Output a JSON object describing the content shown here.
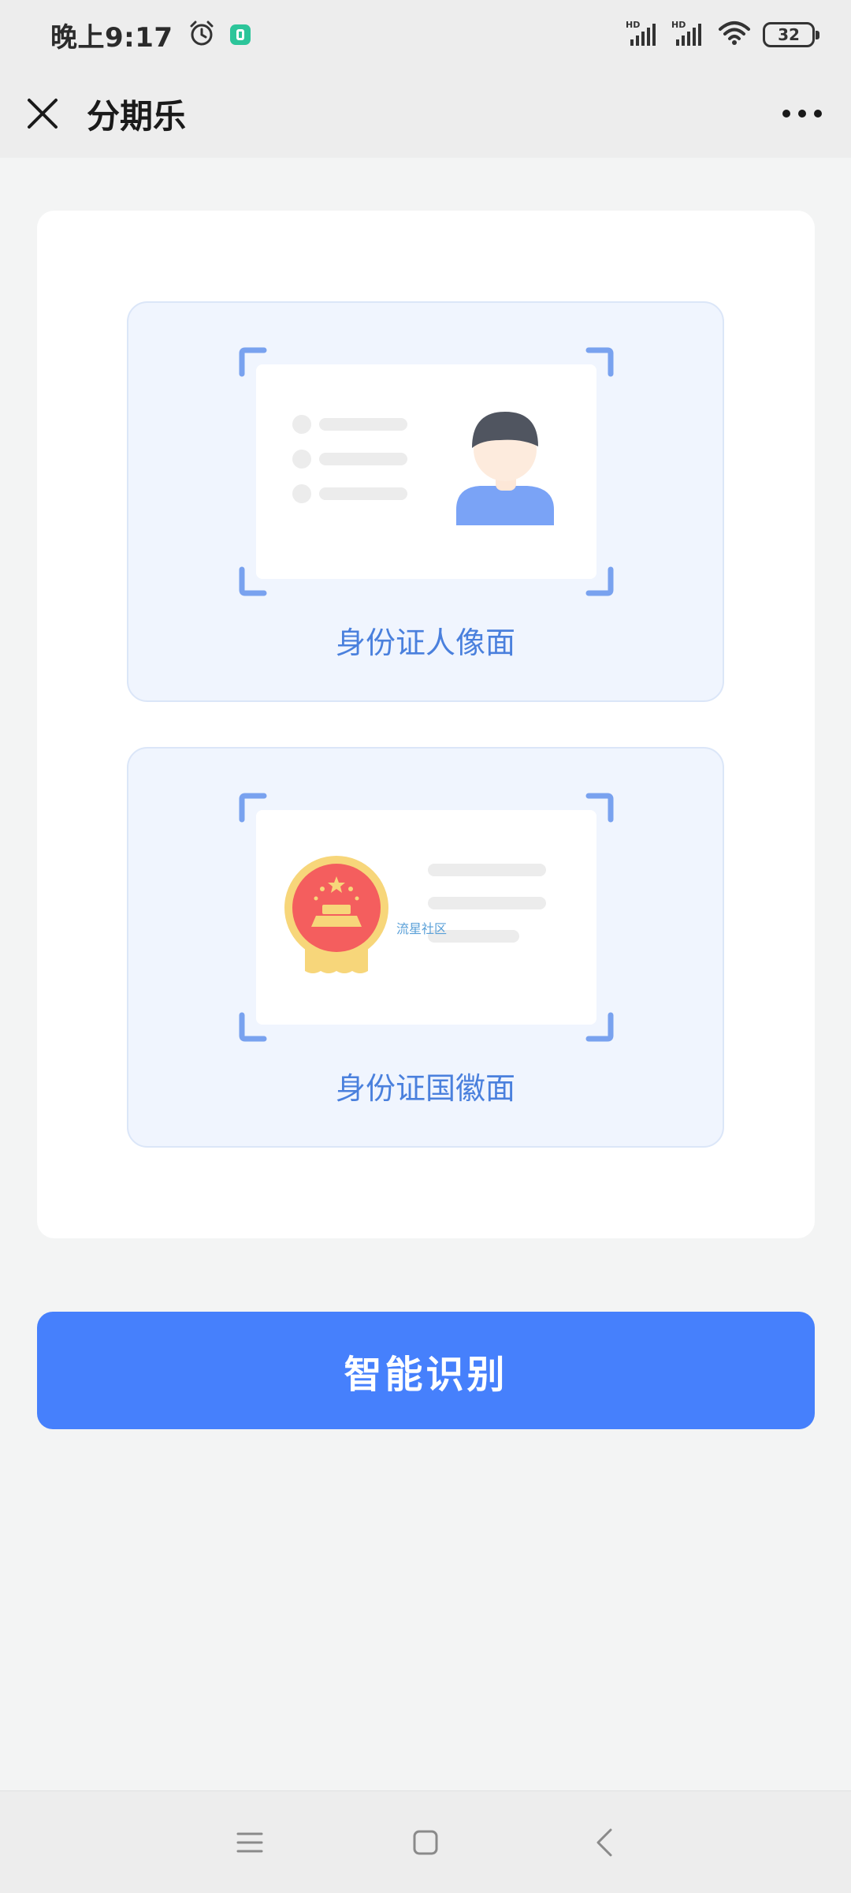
{
  "status_bar": {
    "time": "晚上9:17",
    "battery": "32",
    "signal_labels": [
      "HD",
      "HD"
    ],
    "icons": [
      "alarm-clock-icon",
      "app-notification-icon",
      "signal-icon",
      "signal-icon",
      "wifi-icon",
      "battery-icon"
    ]
  },
  "nav": {
    "title": "分期乐",
    "close_icon": "close-icon",
    "more_icon": "more-dots-icon"
  },
  "id_front": {
    "label": "身份证人像面"
  },
  "id_back": {
    "label": "身份证国徽面",
    "watermark": "流星社区"
  },
  "action_button": {
    "label": "智能识别"
  },
  "system_nav": {
    "icons": [
      "menu-icon",
      "home-icon",
      "back-icon"
    ]
  },
  "colors": {
    "accent": "#4680fc",
    "label_blue": "#4a80dd",
    "panel_bg": "#f0f5fe",
    "page_bg": "#f3f4f4"
  }
}
